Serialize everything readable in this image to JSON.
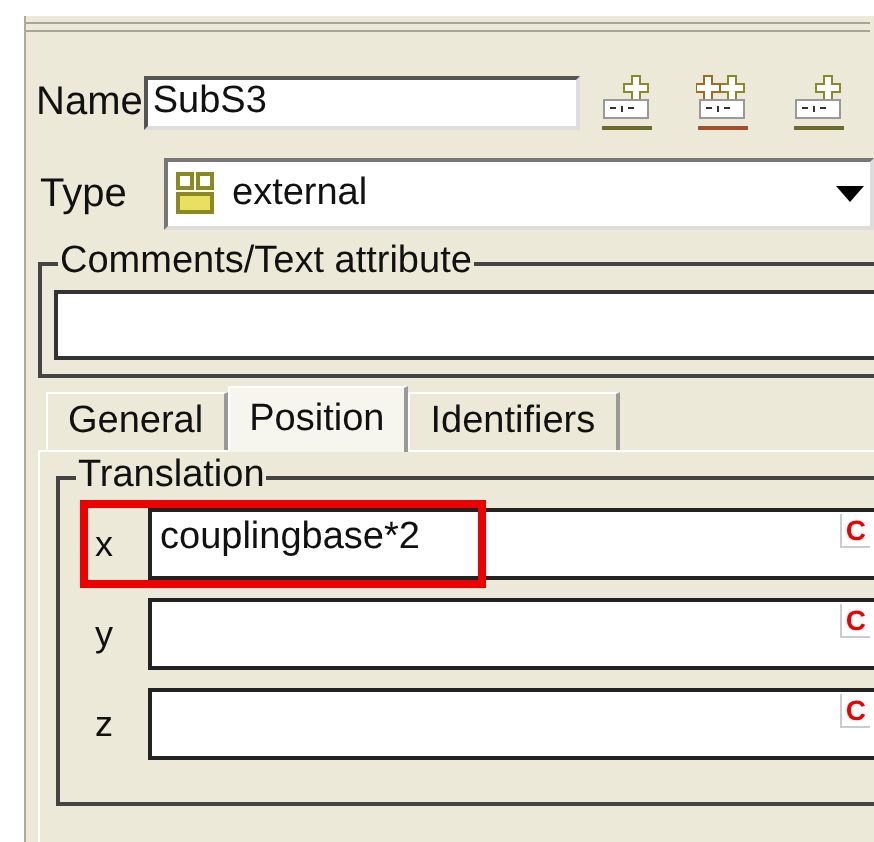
{
  "name": {
    "label": "Name",
    "value": "SubS3"
  },
  "type": {
    "label": "Type",
    "value": "external"
  },
  "comments": {
    "label": "Comments/Text attribute"
  },
  "tabs": [
    {
      "label": "General",
      "selected": false
    },
    {
      "label": "Position",
      "selected": true
    },
    {
      "label": "Identifiers",
      "selected": false
    }
  ],
  "translation": {
    "title": "Translation",
    "fields": [
      {
        "label": "x",
        "value": "couplingbase*2",
        "marker": "C",
        "highlighted": true
      },
      {
        "label": "y",
        "marker": "C",
        "highlighted": false
      },
      {
        "label": "z",
        "marker": "C",
        "highlighted": false
      }
    ]
  }
}
